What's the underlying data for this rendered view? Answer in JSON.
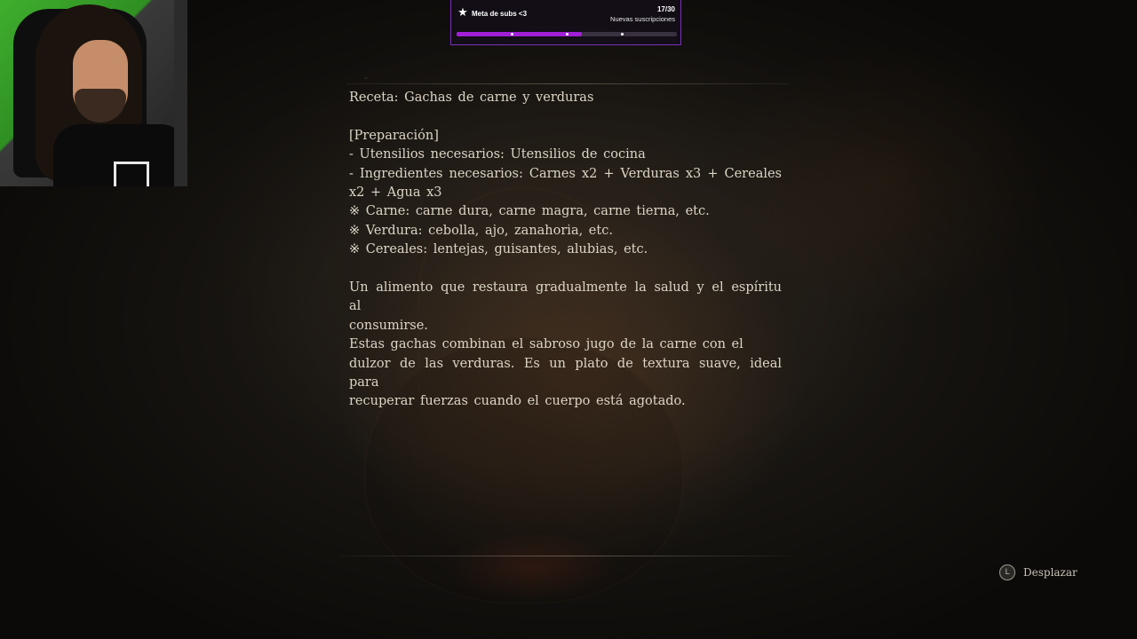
{
  "overlay": {
    "goal": {
      "title": "Meta de subs <3",
      "count": "17/30",
      "subtitle": "Nuevas suscripciones",
      "progress": 0.567,
      "bar_color": "#a11fd6",
      "border_color": "#7a2fb8",
      "icon": "star-icon"
    }
  },
  "document": {
    "title": "Receta: Gachas de carne y verduras",
    "section": "[Preparación]",
    "tools": "- Utensilios necesarios: Utensilios de cocina",
    "ingredients_line1": "- Ingredientes necesarios: Carnes x2 + Verduras x3 + Cereales",
    "ingredients_line2": "x2 + Agua x3",
    "note_meat": "※ Carne: carne dura, carne magra, carne tierna, etc.",
    "note_veg": "※ Verdura: cebolla, ajo, zanahoria, etc.",
    "note_cereal": "※ Cereales: lentejas, guisantes, alubias, etc.",
    "desc_line1": "Un alimento que restaura gradualmente la salud y el espíritu al",
    "desc_line2": "consumirse.",
    "desc_line3": "Estas gachas combinan el sabroso jugo de la carne con el",
    "desc_line4": "dulzor de las verduras. Es un plato de textura suave, ideal para",
    "desc_line5": "recuperar fuerzas cuando el cuerpo está agotado."
  },
  "controls": {
    "scroll_button": "L",
    "scroll_label": "Desplazar"
  }
}
